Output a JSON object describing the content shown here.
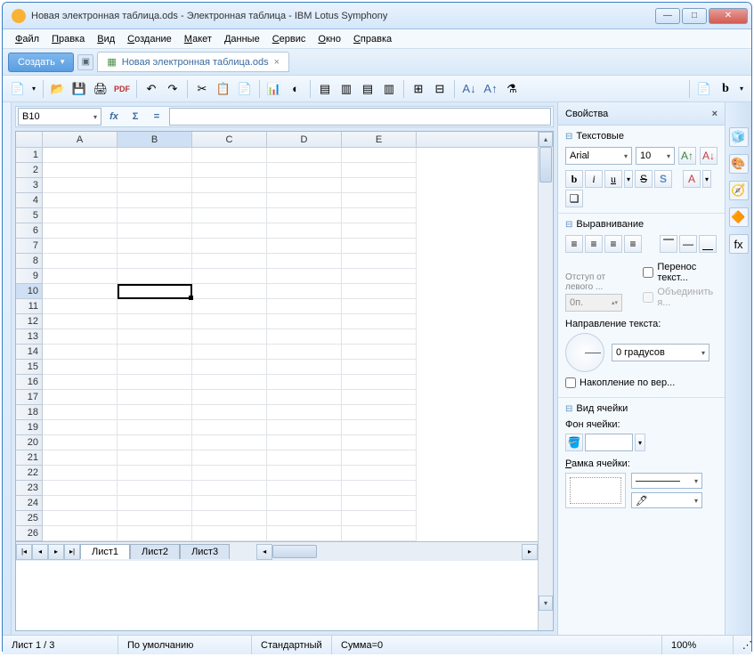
{
  "window": {
    "title": "Новая электронная таблица.ods - Электронная таблица - IBM Lotus Symphony"
  },
  "menu": [
    "Файл",
    "Правка",
    "Вид",
    "Создание",
    "Макет",
    "Данные",
    "Сервис",
    "Окно",
    "Справка"
  ],
  "tabbar": {
    "create": "Создать",
    "doc_name": "Новая электронная таблица.ods"
  },
  "formula": {
    "cell_ref": "B10",
    "equals": "="
  },
  "grid": {
    "columns": [
      "A",
      "B",
      "C",
      "D",
      "E"
    ],
    "rowCount": 26,
    "activeRow": 10,
    "activeCol": "B"
  },
  "sheets": [
    "Лист1",
    "Лист2",
    "Лист3"
  ],
  "panel": {
    "title": "Свойства",
    "text_section": "Текстовые",
    "font_name": "Arial",
    "font_size": "10",
    "align_section": "Выравнивание",
    "indent_label": "Отступ от левого ...",
    "indent_value": "0п.",
    "wrap_label": "Перенос текст...",
    "merge_label": "Объединить я...",
    "direction_label": "Направление текста:",
    "angle_value": "0 градусов",
    "stack_label": "Накопление по вер...",
    "cell_view_section": "Вид ячейки",
    "bg_label": "Фон ячейки:",
    "border_label": "Рамка ячейки:"
  },
  "status": {
    "sheet": "Лист 1 / 3",
    "default": "По умолчанию",
    "std": "Стандартный",
    "sum": "Сумма=0",
    "zoom": "100%"
  }
}
